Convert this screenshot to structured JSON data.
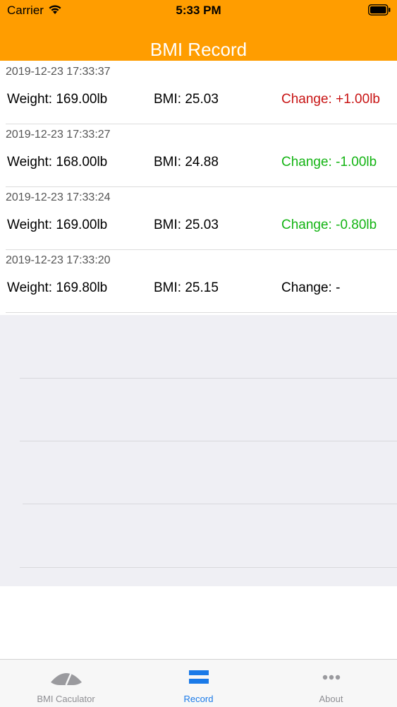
{
  "status_bar": {
    "carrier": "Carrier",
    "time": "5:33 PM"
  },
  "nav": {
    "title": "BMI Record",
    "bar_color": "#ff9d00"
  },
  "records": [
    {
      "timestamp": "2019-12-23 17:33:37",
      "weight": "Weight: 169.00lb",
      "bmi": "BMI: 25.03",
      "change": "Change: +1.00lb",
      "change_color": "#c81414"
    },
    {
      "timestamp": "2019-12-23 17:33:27",
      "weight": "Weight: 168.00lb",
      "bmi": "BMI: 24.88",
      "change": "Change: -1.00lb",
      "change_color": "#14b414"
    },
    {
      "timestamp": "2019-12-23 17:33:24",
      "weight": "Weight: 169.00lb",
      "bmi": "BMI: 25.03",
      "change": "Change: -0.80lb",
      "change_color": "#14b414"
    },
    {
      "timestamp": "2019-12-23 17:33:20",
      "weight": "Weight: 169.80lb",
      "bmi": "BMI: 25.15",
      "change": "Change: -",
      "change_color": "#000000"
    }
  ],
  "tab_bar": {
    "tabs": [
      {
        "label": "BMI Caculator",
        "icon": "gauge-icon",
        "active": false
      },
      {
        "label": "Record",
        "icon": "record-list-icon",
        "active": true
      },
      {
        "label": "About",
        "icon": "more-icon",
        "active": false
      }
    ],
    "active_color": "#1a7ae8",
    "inactive_color": "#8e8e93"
  }
}
